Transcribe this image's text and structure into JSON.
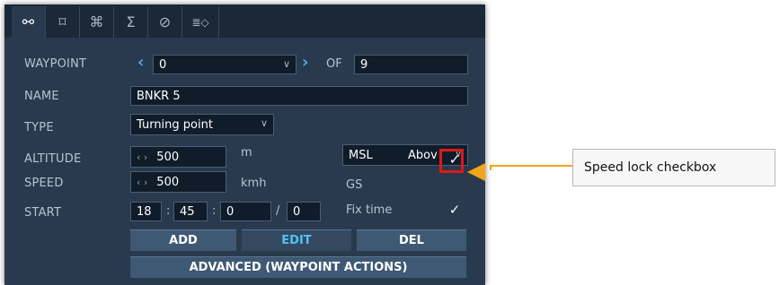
{
  "tabs": [
    {
      "icon": "route-icon"
    },
    {
      "icon": "target-icon"
    },
    {
      "icon": "command-icon"
    },
    {
      "icon": "sigma-icon"
    },
    {
      "icon": "slash-circle-icon"
    },
    {
      "icon": "list-arrow-icon"
    }
  ],
  "tab_glyphs": [
    "⚯",
    "⌑",
    "⌘",
    "Σ",
    "⊘",
    "≣◇"
  ],
  "form": {
    "waypoint_label": "WAYPOINT",
    "waypoint_value": "0",
    "of_label": "OF",
    "waypoint_total": "9",
    "name_label": "NAME",
    "name_value": "BNKR 5",
    "type_label": "TYPE",
    "type_value": "Turning point",
    "altitude_label": "ALTITUDE",
    "altitude_value": "500",
    "altitude_unit": "m",
    "altitude_ref": "MSL",
    "altitude_ref2": "Abov",
    "speed_label": "SPEED",
    "speed_value": "500",
    "speed_unit": "kmh",
    "gs_label": "GS",
    "start_label": "START",
    "start_h": "18",
    "start_m": "45",
    "start_s": "0",
    "start_d": "0",
    "fix_time_label": "Fix time"
  },
  "buttons": {
    "add": "ADD",
    "edit": "EDIT",
    "del": "DEL",
    "advanced": "ADVANCED (WAYPOINT ACTIONS)"
  },
  "callout": {
    "text": "Speed lock checkbox"
  },
  "colors": {
    "panel": "#293a4e",
    "accent": "#4fa9ee",
    "callout_line": "#f5a31a",
    "highlight": "#e01818"
  }
}
